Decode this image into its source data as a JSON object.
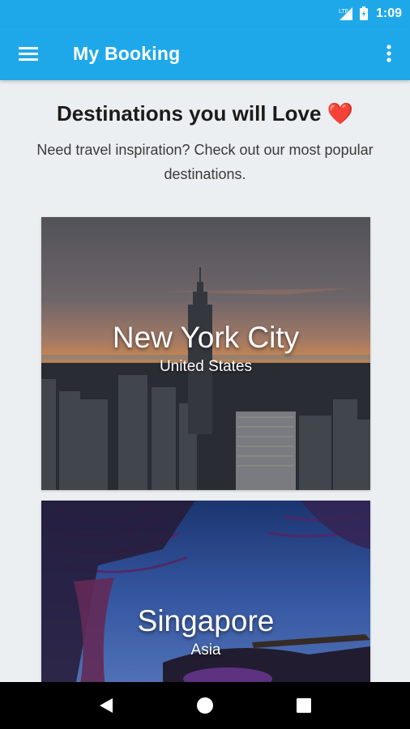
{
  "status_bar": {
    "network_label": "LTE",
    "time": "1:09",
    "icons": [
      "lte-signal-icon",
      "battery-charging-icon"
    ]
  },
  "app_bar": {
    "title": "My Booking",
    "menu_icon": "hamburger-menu-icon",
    "overflow_icon": "more-vert-icon",
    "color": "#1ea8ea"
  },
  "main": {
    "heading": "Destinations you will Love",
    "heading_emoji": "❤️",
    "subtitle": "Need travel inspiration? Check out our most popular destinations."
  },
  "destinations": [
    {
      "name": "New York City",
      "region": "United States"
    },
    {
      "name": "Singapore",
      "region": "Asia"
    }
  ],
  "nav_bar": {
    "icons": [
      "back-triangle-icon",
      "home-circle-icon",
      "recents-square-icon"
    ]
  },
  "colors": {
    "accent": "#1ea8ea",
    "background": "#eceff1",
    "heart": "#e53935"
  }
}
